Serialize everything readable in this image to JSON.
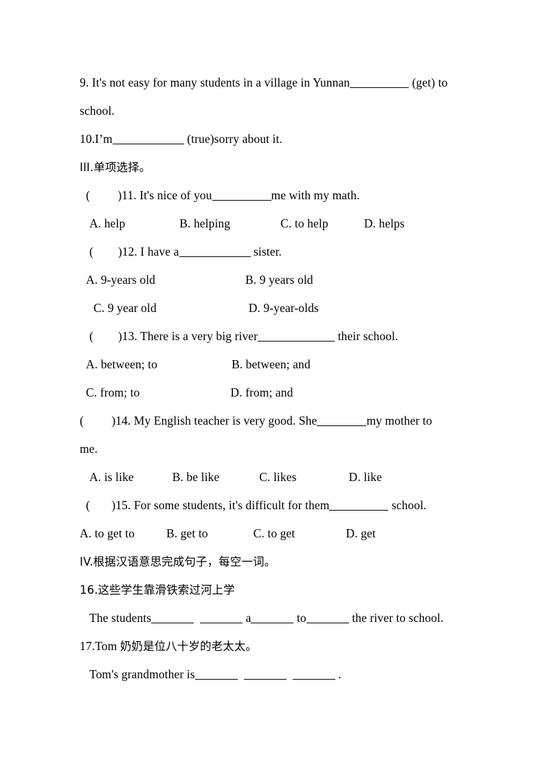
{
  "document": {
    "type": "english-worksheet-page",
    "background_color": "#ffffff",
    "text_color": "#000000"
  },
  "q9": {
    "line1_pre": "9. It's not easy for many students in a village in Yunnan",
    "line1_post": " (get) to",
    "line2": "school."
  },
  "q10": {
    "pre": "10.I’m",
    "post": " (true)sorry about it."
  },
  "section3": {
    "heading": "III.单项选择。"
  },
  "q11": {
    "bracket": "(         )",
    "number_pre": "11. It's nice of you",
    "post": "me with my math.",
    "options": [
      "A. help",
      "B. helping",
      "C. to help",
      "D. helps"
    ]
  },
  "q12": {
    "bracket": "(        )",
    "number_pre": "12. I have a",
    "post": " sister.",
    "options_row1": [
      "A. 9-years old",
      "B. 9 years old"
    ],
    "options_row2": [
      "C. 9 year old",
      "D. 9-year-olds"
    ]
  },
  "q13": {
    "bracket": "(        )",
    "number_pre": "13. There is a very big river",
    "post": " their school.",
    "options_row1": [
      "A. between; to",
      "B. between; and"
    ],
    "options_row2": [
      "C. from; to",
      "D. from; and"
    ]
  },
  "q14": {
    "bracket": "(         )",
    "number_pre": "14. My English teacher is very good. She",
    "post": "my mother to",
    "line2": "me.",
    "options": [
      "A. is like",
      "B. be like",
      "C. likes",
      "D. like"
    ]
  },
  "q15": {
    "bracket": "(       )",
    "number_pre": "15. For some students, it's difficult for them",
    "post": " school.",
    "options": [
      "A. to get to",
      "B. get to",
      "C. to get",
      "D. get"
    ]
  },
  "section4": {
    "heading": "IV.根据汉语意思完成句子，每空一词。"
  },
  "q16": {
    "chinese": "16.这些学生靠滑铁索过河上学",
    "answer_p1": "The students",
    "answer_p2": "  ",
    "answer_p3": " a",
    "answer_p4": " to",
    "answer_p5": " the river to school."
  },
  "q17": {
    "chinese_num": "17.Tom ",
    "chinese_text": "奶奶是位八十岁的老太太。",
    "answer_pre": "Tom's grandmother is",
    "answer_post": " ."
  }
}
